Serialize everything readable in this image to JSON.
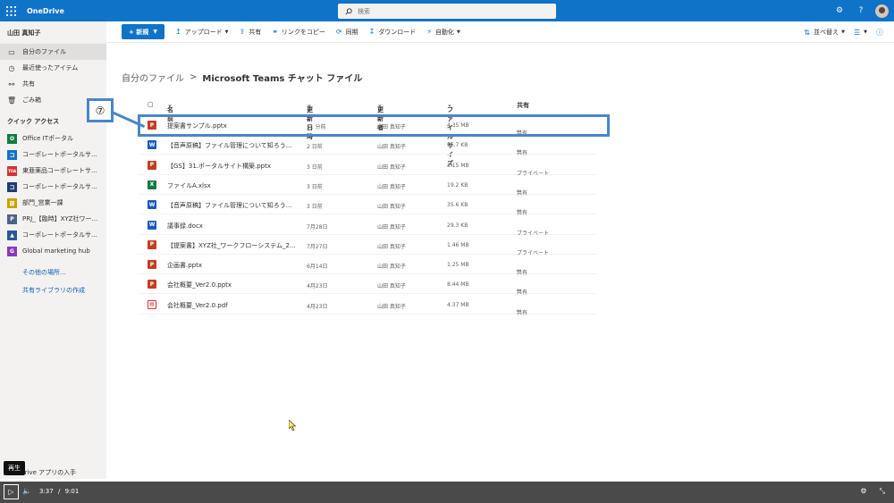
{
  "topbar": {
    "app_title": "OneDrive",
    "search_placeholder": "検索",
    "settings_icon": "gear-icon",
    "help_label": "?"
  },
  "sidebar": {
    "user_name": "山田 真知子",
    "nav": [
      {
        "label": "自分のファイル",
        "icon": "folder-icon",
        "active": true
      },
      {
        "label": "最近使ったアイテム",
        "icon": "clock-icon"
      },
      {
        "label": "共有",
        "icon": "share-icon"
      },
      {
        "label": "ごみ箱",
        "icon": "trash-icon"
      }
    ],
    "quick_access_title": "クイック アクセス",
    "quick_access": [
      {
        "label": "Office ITポータル",
        "color": "#107c41",
        "glyph": "O"
      },
      {
        "label": "コーポレートポータルサ...",
        "color": "#0f73c8",
        "glyph": "コ"
      },
      {
        "label": "東亜薬品コーポレートサ...",
        "color": "#d13438",
        "glyph": "TOA"
      },
      {
        "label": "コーポレートポータルサ...",
        "color": "#1f3b73",
        "glyph": "コ"
      },
      {
        "label": "部門_営業一課",
        "color": "#c8a200",
        "glyph": "部"
      },
      {
        "label": "PRJ_【臨時】XYZ社ワー...",
        "color": "#4b6584",
        "glyph": "P"
      },
      {
        "label": "コーポレートポータルサ...",
        "color": "#2b579a",
        "glyph": "▲"
      },
      {
        "label": "Global marketing hub",
        "color": "#8a3ab9",
        "glyph": "G"
      }
    ],
    "more_places": "その他の場所...",
    "create_library": "共有ライブラリの作成",
    "bottom_text": "OneDrive アプリの入手"
  },
  "cmdbar": {
    "new_label": "+ 新規",
    "commands": [
      {
        "label": "アップロード",
        "icon": "upload-icon"
      },
      {
        "label": "共有",
        "icon": "share-icon"
      },
      {
        "label": "リンクをコピー",
        "icon": "link-icon"
      },
      {
        "label": "同期",
        "icon": "sync-icon"
      },
      {
        "label": "ダウンロード",
        "icon": "download-icon"
      },
      {
        "label": "自動化",
        "icon": "automate-icon"
      }
    ],
    "sort_label": "並べ替え"
  },
  "breadcrumb": {
    "parent": "自分のファイル",
    "separator": ">",
    "current": "Microsoft Teams チャット ファイル"
  },
  "table": {
    "headers": {
      "name": "名前",
      "modified": "更新日時",
      "modified_by": "更新者",
      "size": "ファイル サイズ",
      "sharing": "共有"
    },
    "rows": [
      {
        "name": "提案書サンプル.pptx",
        "type": "pptx",
        "modified": "11 分前",
        "by": "山田 真知子",
        "size": "4.35 MB",
        "sharing": "共有"
      },
      {
        "name": "【音声原稿】ファイル管理について知ろう...",
        "type": "docx",
        "modified": "2 日前",
        "by": "山田 真知子",
        "size": "35.7 KB",
        "sharing": "共有"
      },
      {
        "name": "【GS】31.ポータルサイト構築.pptx",
        "type": "pptx",
        "modified": "3 日前",
        "by": "山田 真知子",
        "size": "3.15 MB",
        "sharing": "プライベート"
      },
      {
        "name": "ファイルA.xlsx",
        "type": "xlsx",
        "modified": "3 日前",
        "by": "山田 真知子",
        "size": "19.2 KB",
        "sharing": "共有"
      },
      {
        "name": "【音声原稿】ファイル管理について知ろう...",
        "type": "docx",
        "modified": "3 日前",
        "by": "山田 真知子",
        "size": "35.6 KB",
        "sharing": "共有"
      },
      {
        "name": "議事録.docx",
        "type": "docx",
        "modified": "7月28日",
        "by": "山田 真知子",
        "size": "29.3 KB",
        "sharing": "プライベート"
      },
      {
        "name": "【提案書】XYZ社_ワークフローシステム_2...",
        "type": "pptx",
        "modified": "7月27日",
        "by": "山田 真知子",
        "size": "1.46 MB",
        "sharing": "プライベート"
      },
      {
        "name": "企画書.pptx",
        "type": "pptx",
        "modified": "6月14日",
        "by": "山田 真知子",
        "size": "1.25 MB",
        "sharing": "共有"
      },
      {
        "name": "会社概要_Ver2.0.pptx",
        "type": "pptx",
        "modified": "4月23日",
        "by": "山田 真知子",
        "size": "8.44 MB",
        "sharing": "共有"
      },
      {
        "name": "会社概要_Ver2.0.pdf",
        "type": "pdf",
        "modified": "4月23日",
        "by": "山田 真知子",
        "size": "4.37 MB",
        "sharing": "共有"
      }
    ]
  },
  "annotation": {
    "callout_number": "⑦",
    "color": "#4a86c8"
  },
  "video": {
    "tooltip": "再生",
    "current_time": "3:37",
    "separator": "/",
    "duration": "9:01",
    "progress": 0.401
  }
}
